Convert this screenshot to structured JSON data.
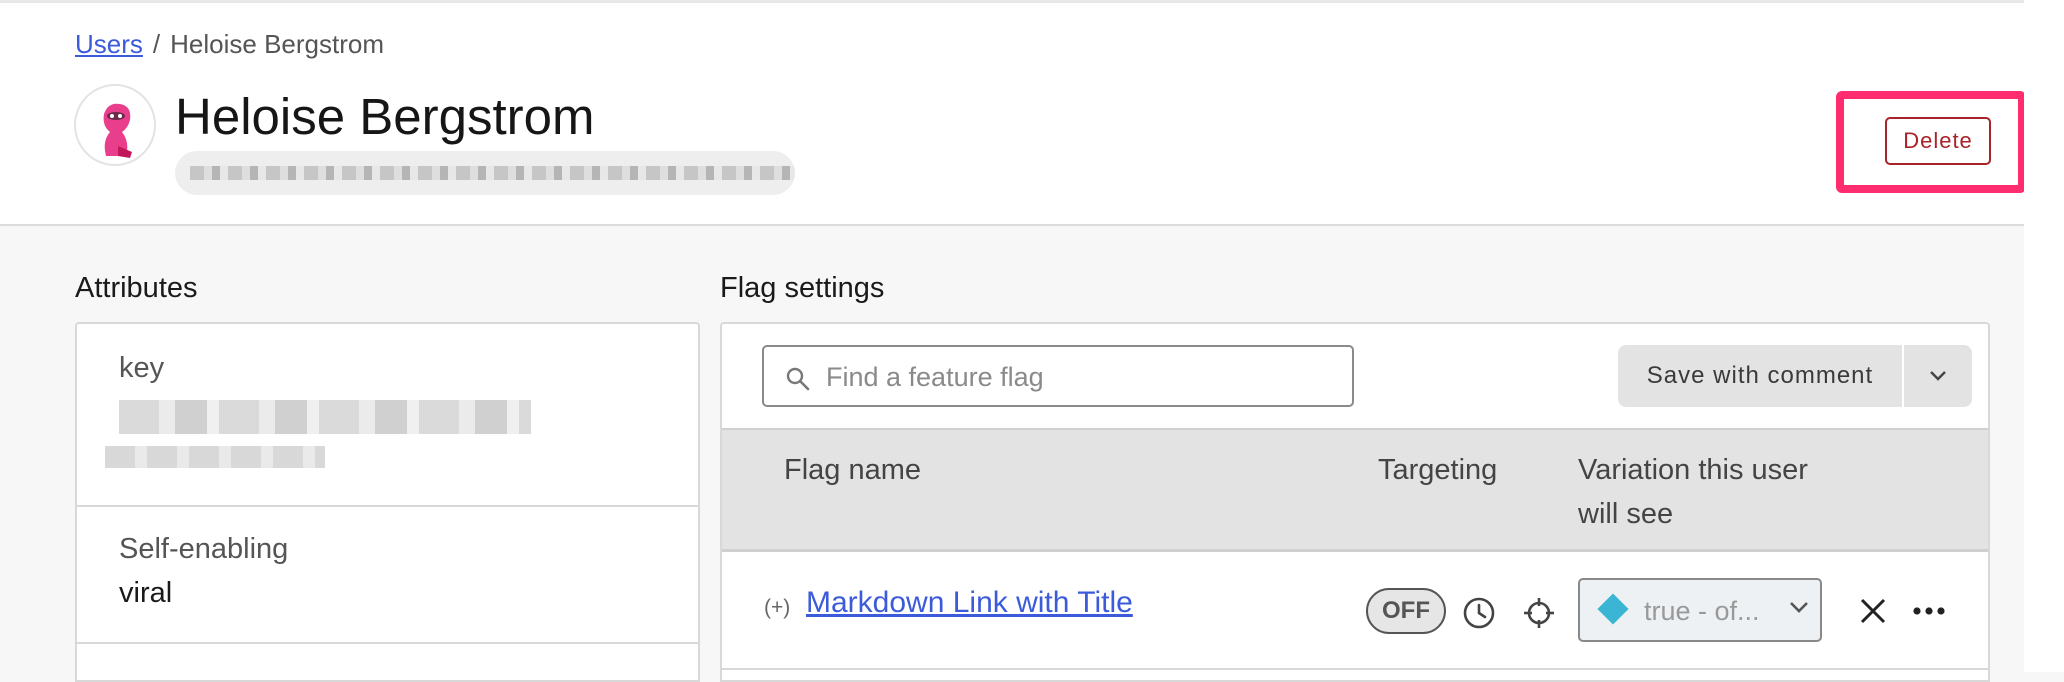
{
  "breadcrumb": {
    "root": "Users",
    "separator": "/",
    "current": "Heloise Bergstrom"
  },
  "user": {
    "name": "Heloise Bergstrom"
  },
  "actions": {
    "delete_label": "Delete"
  },
  "attributes": {
    "title": "Attributes",
    "items": [
      {
        "label": "key",
        "value": ""
      },
      {
        "label": "Self-enabling",
        "value": "viral"
      }
    ]
  },
  "flags": {
    "title": "Flag settings",
    "search_placeholder": "Find a feature flag",
    "save_label": "Save with comment",
    "columns": {
      "name": "Flag name",
      "targeting": "Targeting",
      "variation_line1": "Variation this user",
      "variation_line2": "will see"
    },
    "rows": [
      {
        "prefix": "(+)",
        "name": "Markdown Link with Title",
        "targeting": "OFF",
        "variation": "true - of..."
      }
    ]
  },
  "colors": {
    "accent": "#3b5bdb",
    "danger": "#a8232a",
    "highlight": "#ff2d6f",
    "variation_diamond": "#3ab6d4"
  }
}
